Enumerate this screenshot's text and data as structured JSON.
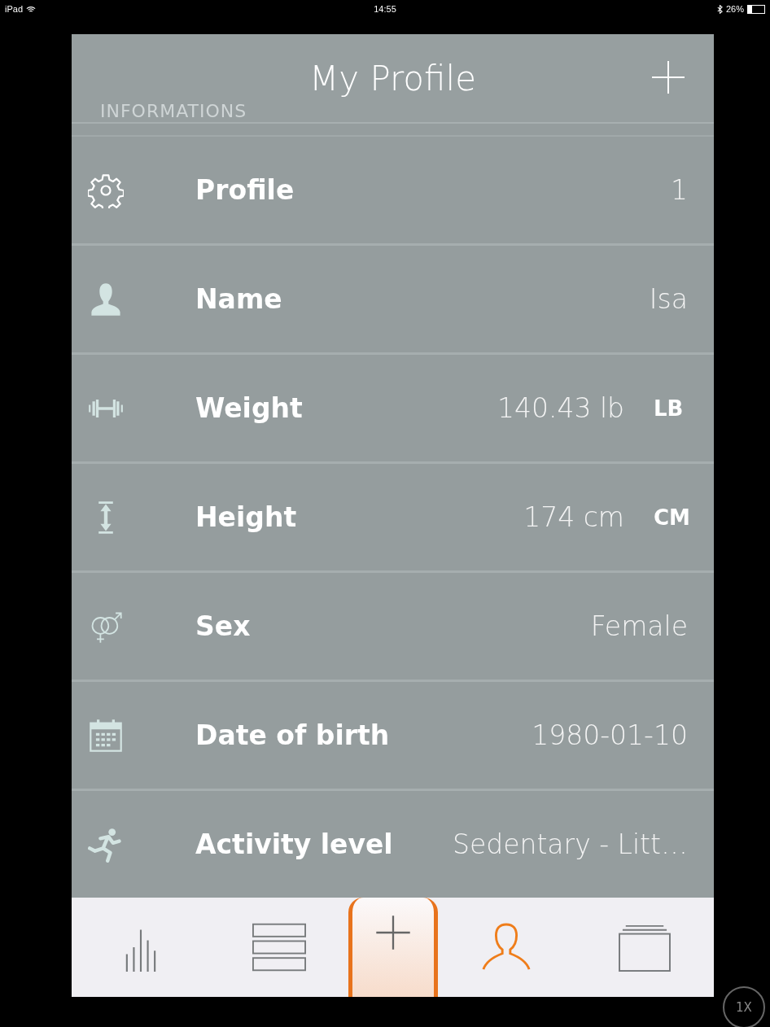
{
  "status_bar": {
    "carrier": "iPad",
    "time": "14:55",
    "battery": "26%"
  },
  "header": {
    "title": "My Profile",
    "section": "INFORMATIONS"
  },
  "rows": [
    {
      "kind": "gear",
      "label": "Profile",
      "value": "1"
    },
    {
      "kind": "person",
      "label": "Name",
      "value": "Isa"
    },
    {
      "kind": "dumbbell",
      "label": "Weight",
      "value": "140.43 lb",
      "unit": "LB"
    },
    {
      "kind": "height",
      "label": "Height",
      "value": "174 cm",
      "unit": "CM"
    },
    {
      "kind": "sex",
      "label": "Sex",
      "value": "Female"
    },
    {
      "kind": "calendar",
      "label": "Date of birth",
      "value": "1980-01-10"
    },
    {
      "kind": "runner",
      "label": "Activity level",
      "value": "Sedentary - Litt…"
    }
  ],
  "tabs": [
    {
      "kind": "bars",
      "selected": false
    },
    {
      "kind": "list",
      "selected": false
    },
    {
      "kind": "add",
      "selected": false
    },
    {
      "kind": "person",
      "selected": true
    },
    {
      "kind": "stack",
      "selected": false
    }
  ],
  "zoom_badge": "1X"
}
